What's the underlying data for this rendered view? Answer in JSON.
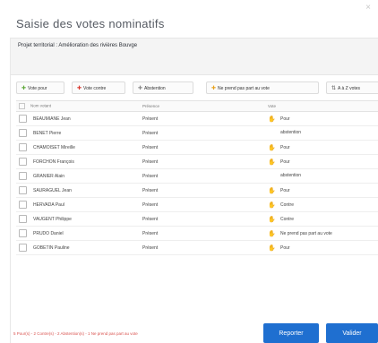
{
  "dialog": {
    "title": "Saisie des votes nominatifs",
    "subject": "Projet territorial : Amélioration des rivières Bouvge"
  },
  "toolbar": {
    "pour_label": "Vote pour",
    "contre_label": "Vote contre",
    "abstention_label": "Abstention",
    "nppv_label": "Ne prend pas part au vote",
    "az_label": "A à Z votes"
  },
  "table": {
    "headers": {
      "name": "Nom votant",
      "presence": "Présence",
      "vote": "Vote"
    },
    "rows": [
      {
        "name": "BEAUMIANE Jean",
        "presence": "Présent",
        "vote": "Pour",
        "vote_type": "pour"
      },
      {
        "name": "BENET Pierre",
        "presence": "Présent",
        "vote": "abstention",
        "vote_type": "abstention"
      },
      {
        "name": "CHAMOISET Mireille",
        "presence": "Présent",
        "vote": "Pour",
        "vote_type": "pour"
      },
      {
        "name": "FORCHON François",
        "presence": "Présent",
        "vote": "Pour",
        "vote_type": "pour"
      },
      {
        "name": "GRANIER Alain",
        "presence": "Présent",
        "vote": "abstention",
        "vote_type": "abstention"
      },
      {
        "name": "SAURAGUEL Jean",
        "presence": "Présent",
        "vote": "Pour",
        "vote_type": "pour"
      },
      {
        "name": "HERVADA Paul",
        "presence": "Présent",
        "vote": "Contre",
        "vote_type": "contre"
      },
      {
        "name": "VAUGENT Philippe",
        "presence": "Présent",
        "vote": "Contre",
        "vote_type": "contre"
      },
      {
        "name": "PRUDO Daniel",
        "presence": "Présent",
        "vote": "Ne prend pas part au vote",
        "vote_type": "nppv"
      },
      {
        "name": "GOBETIN Pauline",
        "presence": "Présent",
        "vote": "Pour",
        "vote_type": "pour"
      }
    ]
  },
  "footer": {
    "summary": "5 Pour(s) - 2 Contre(s) - 2 Abstention(s) - 1 Ne prend pas part au vote",
    "reporter_label": "Reporter",
    "valider_label": "Valider"
  },
  "colors": {
    "pour": "#5fa83a",
    "contre": "#d9342b",
    "abstention": "#888888",
    "nppv": "#e8a21c",
    "primary_button": "#1f6fd0"
  }
}
